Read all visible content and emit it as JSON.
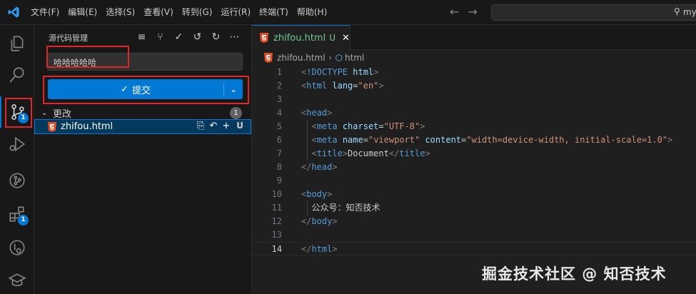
{
  "menu": [
    "文件(F)",
    "编辑(E)",
    "选择(S)",
    "查看(V)",
    "转到(G)",
    "运行(R)",
    "终端(T)",
    "帮助(H)"
  ],
  "command_center": {
    "text": "my"
  },
  "activity_badges": {
    "scm": "1",
    "extensions": "1"
  },
  "sidebar": {
    "title": "源代码管理",
    "commit_message": "哈哈哈哈哈",
    "commit_label": "提交",
    "changes_label": "更改",
    "changes_count": "1",
    "file": {
      "name": "zhifou.html",
      "status": "U"
    }
  },
  "editor": {
    "tab": {
      "name": "zhifou.html",
      "status": "U"
    },
    "breadcrumb": {
      "file": "zhifou.html",
      "symbol": "html"
    },
    "current_line": 14,
    "line_numbers": [
      "1",
      "2",
      "3",
      "4",
      "5",
      "6",
      "7",
      "8",
      "9",
      "10",
      "11",
      "12",
      "13",
      "14"
    ]
  },
  "watermark": "掘金技术社区 @ 知否技术",
  "colors": {
    "accent": "#0078d4",
    "highlight_box": "#e0262b",
    "untracked": "#73c991"
  }
}
